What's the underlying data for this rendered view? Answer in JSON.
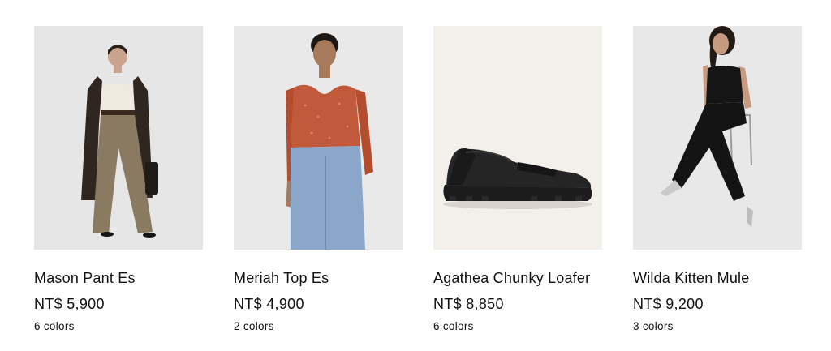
{
  "products": [
    {
      "name": "Mason Pant Es",
      "price": "NT$ 5,900",
      "colors": "6 colors",
      "bg_color": "#e6e6e6"
    },
    {
      "name": "Meriah Top Es",
      "price": "NT$ 4,900",
      "colors": "2 colors",
      "bg_color": "#e9e9e9"
    },
    {
      "name": "Agathea Chunky Loafer",
      "price": "NT$ 8,850",
      "colors": "6 colors",
      "bg_color": "#f3f0eb"
    },
    {
      "name": "Wilda Kitten Mule",
      "price": "NT$ 9,200",
      "colors": "3 colors",
      "bg_color": "#e8e8e8"
    }
  ]
}
